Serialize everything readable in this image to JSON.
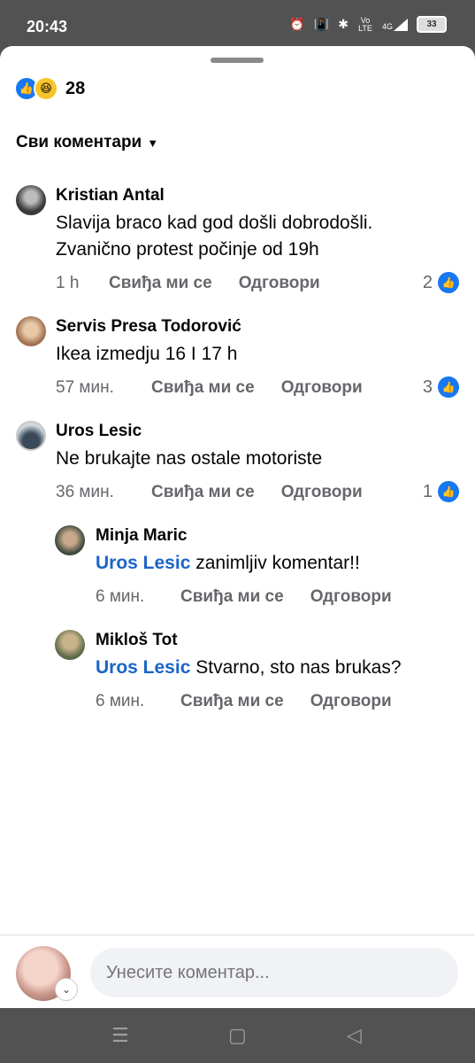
{
  "status": {
    "time": "20:43",
    "battery": "33",
    "network": "4G",
    "volte": "Vo LTE"
  },
  "reactions": {
    "count": "28"
  },
  "filter": {
    "label": "Сви коментари"
  },
  "comments": [
    {
      "author": "Kristian Antal",
      "text_lines": [
        "Slavija braco kad god došli dobrodošli.",
        "Zvanično protest počinje od 19h"
      ],
      "time": "1 h",
      "like_label": "Свиђа ми се",
      "reply_label": "Одговори",
      "like_count": "2"
    },
    {
      "author": "Servis Presa Todorović",
      "text_lines": [
        "Ikea izmedju 16 I 17 h"
      ],
      "time": "57 мин.",
      "like_label": "Свиђа ми се",
      "reply_label": "Одговори",
      "like_count": "3"
    },
    {
      "author": "Uros Lesic",
      "text_lines": [
        "Ne brukajte nas ostale motoriste"
      ],
      "time": "36 мин.",
      "like_label": "Свиђа ми се",
      "reply_label": "Одговори",
      "like_count": "1"
    }
  ],
  "replies": [
    {
      "author": "Minja Maric",
      "mention": "Uros Lesic",
      "text": " zanimljiv komentar!!",
      "time": "6 мин.",
      "like_label": "Свиђа ми се",
      "reply_label": "Одговори"
    },
    {
      "author": "Mikloš Tot",
      "mention": "Uros Lesic",
      "text": " Stvarno, sto nas brukas?",
      "time": "6 мин.",
      "like_label": "Свиђа ми се",
      "reply_label": "Одговори"
    }
  ],
  "composer": {
    "placeholder": "Унесите коментар..."
  },
  "icons": [
    "alarm-icon",
    "vibrate-icon",
    "bluetooth-icon",
    "signal-icon",
    "battery-icon",
    "like-icon",
    "haha-icon",
    "chevron-down-icon",
    "menu-icon",
    "home-icon",
    "back-icon"
  ],
  "colors": {
    "like_blue": "#1877f2",
    "mention_blue": "#1b64c8",
    "meta_gray": "#65676b"
  }
}
